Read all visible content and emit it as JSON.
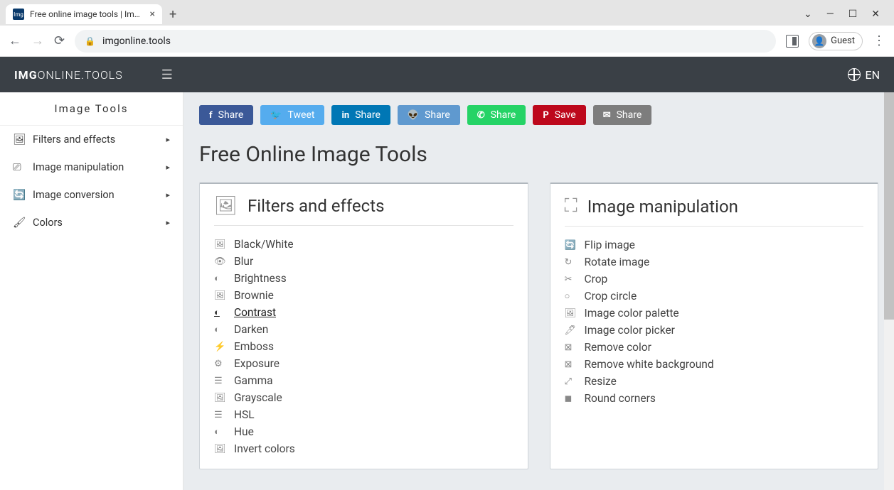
{
  "browser": {
    "tab_title": "Free online image tools | ImgOnl",
    "url": "imgonline.tools",
    "guest_label": "Guest"
  },
  "header": {
    "logo_strong": "IMG",
    "logo_rest": "ONLINE.TOOLS",
    "lang": "EN"
  },
  "sidebar": {
    "title": "Image Tools",
    "items": [
      {
        "label": "Filters and effects"
      },
      {
        "label": "Image manipulation"
      },
      {
        "label": "Image conversion"
      },
      {
        "label": "Colors"
      }
    ]
  },
  "share": {
    "fb": "Share",
    "tw": "Tweet",
    "li": "Share",
    "rd": "Share",
    "wa": "Share",
    "pn": "Save",
    "em": "Share"
  },
  "main": {
    "title": "Free Online Image Tools",
    "filters_card": {
      "title": "Filters and effects",
      "items": [
        {
          "label": "Black/White"
        },
        {
          "label": "Blur"
        },
        {
          "label": "Brightness"
        },
        {
          "label": "Brownie"
        },
        {
          "label": "Contrast",
          "hover": true
        },
        {
          "label": "Darken"
        },
        {
          "label": "Emboss"
        },
        {
          "label": "Exposure"
        },
        {
          "label": "Gamma"
        },
        {
          "label": "Grayscale"
        },
        {
          "label": "HSL"
        },
        {
          "label": "Hue"
        },
        {
          "label": "Invert colors"
        }
      ]
    },
    "manip_card": {
      "title": "Image manipulation",
      "items": [
        {
          "label": "Flip image"
        },
        {
          "label": "Rotate image"
        },
        {
          "label": "Crop"
        },
        {
          "label": "Crop circle"
        },
        {
          "label": "Image color palette"
        },
        {
          "label": "Image color picker"
        },
        {
          "label": "Remove color"
        },
        {
          "label": "Remove white background"
        },
        {
          "label": "Resize"
        },
        {
          "label": "Round corners"
        }
      ]
    }
  }
}
